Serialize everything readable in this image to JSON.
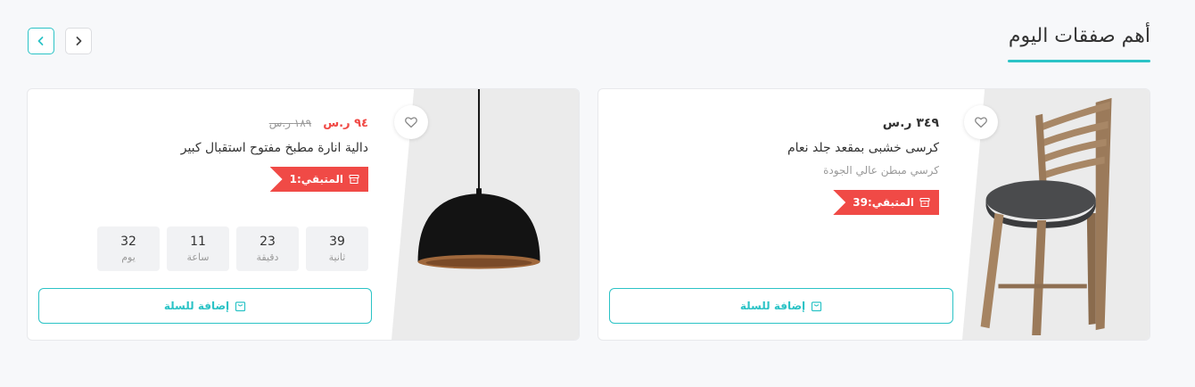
{
  "section": {
    "title": "أهم صفقات اليوم"
  },
  "colors": {
    "accent": "#2bc3c6",
    "sale": "#f04a46"
  },
  "nav": {
    "prev_icon": "chevron-left-icon",
    "next_icon": "chevron-right-icon"
  },
  "products": [
    {
      "price": "٣٤٩ ر.س",
      "name": "كرسى خشبى بمقعد جلد نعام",
      "subtitle": "كرسي مبطن عالي الجودة",
      "remaining_label": "المتبقي:",
      "remaining_count": "39",
      "cart_label": "إضافة للسلة"
    },
    {
      "sale_price": "٩٤ ر.س",
      "old_price": "١٨٩ ر.س",
      "name": "دالية انارة مطبخ مفتوح استقبال كبير",
      "remaining_label": "المتبقي:",
      "remaining_count": "1",
      "countdown": [
        {
          "value": "39",
          "unit": "ثانية"
        },
        {
          "value": "23",
          "unit": "دقيقة"
        },
        {
          "value": "11",
          "unit": "ساعة"
        },
        {
          "value": "32",
          "unit": "يوم"
        }
      ],
      "cart_label": "إضافة للسلة"
    }
  ]
}
